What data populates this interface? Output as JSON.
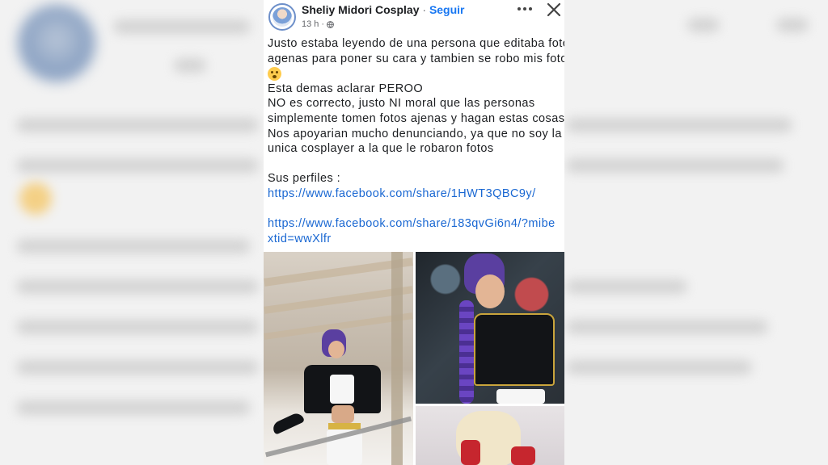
{
  "post": {
    "author": "Sheliy Midori Cosplay",
    "separator": "·",
    "follow_label": "Seguir",
    "time": "13 h",
    "time_separator": "·",
    "icons": [
      "globe-icon",
      "more-icon",
      "close-icon",
      "flushed-emoji-icon"
    ],
    "body": {
      "line1": "Justo estaba leyendo de una persona que editaba fotos",
      "line2": "agenas para poner su cara y tambien se robo mis fotos",
      "line4": "Esta demas aclarar PEROO",
      "line5": "NO es correcto, justo NI moral que las personas",
      "line6": "simplemente tomen fotos ajenas y hagan estas cosas.",
      "line7": "Nos apoyarian mucho denunciando, ya que no soy la",
      "line8": "unica cosplayer a la que le robaron fotos",
      "line9": "Sus perfiles :",
      "link1": "https://www.facebook.com/share/1HWT3QBC9y/",
      "link2a": "https://www.facebook.com/share/183qvGi6n4/?mibe",
      "link2b": "xtid=wwXlfr"
    }
  },
  "colors": {
    "link": "#1967d2",
    "follow": "#1877f2",
    "text": "#1c1e21",
    "meta": "#65676b"
  }
}
